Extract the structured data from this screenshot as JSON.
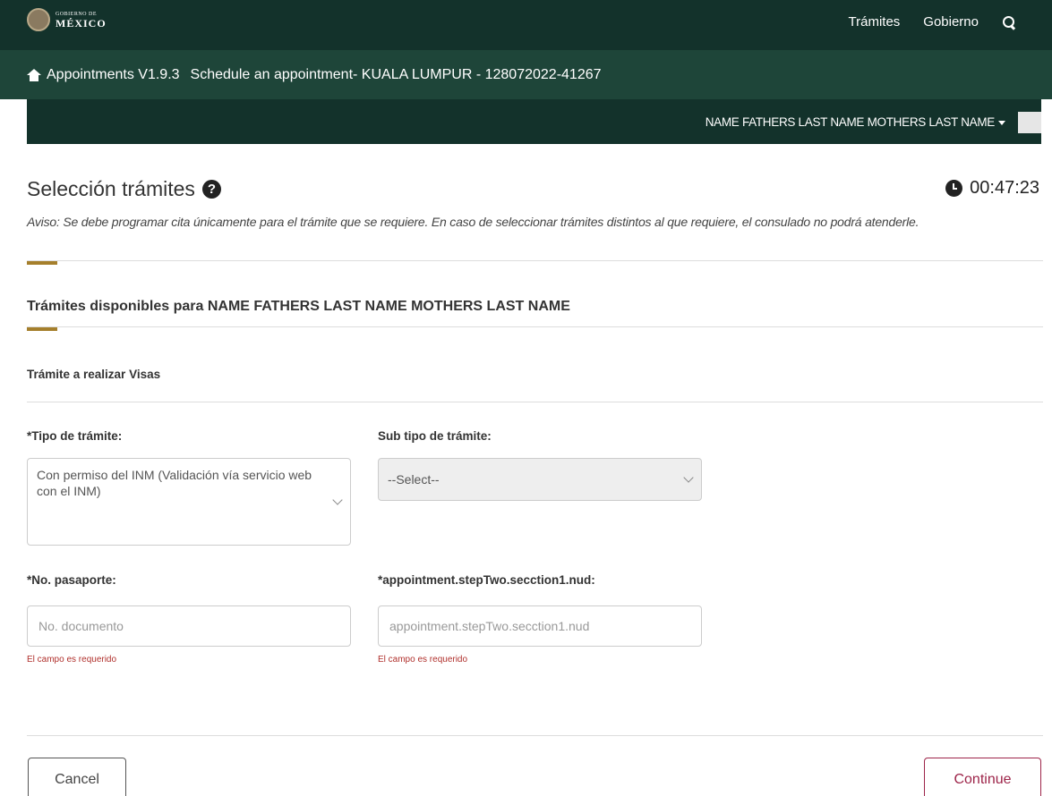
{
  "gov_header": {
    "logo_small": "GOBIERNO DE",
    "logo_big": "MÉXICO",
    "nav": [
      "Trámites",
      "Gobierno"
    ],
    "search_icon": "search-icon"
  },
  "breadcrumb": {
    "home_icon": "home-icon",
    "app": "Appointments V1.9.3",
    "page": "Schedule an appointment- KUALA LUMPUR - 128072022-41267"
  },
  "user_menu": {
    "name": "NAME FATHERS LAST NAME MOTHERS LAST NAME"
  },
  "heading": {
    "title": "Selección trámites",
    "help_icon": "question-circle-icon",
    "timer": "00:47:23",
    "timer_icon": "clock-icon"
  },
  "notice": "Aviso: Se debe programar cita únicamente para el trámite que se requiere. En caso de seleccionar trámites distintos al que requiere, el consulado no podrá atenderle.",
  "section": {
    "title": "Trámites disponibles para NAME FATHERS LAST NAME MOTHERS LAST NAME",
    "subtitle": "Trámite a realizar Visas"
  },
  "form": {
    "tipo": {
      "label": "*Tipo de trámite:",
      "value": "Con permiso del INM (Validación vía servicio web con el INM)"
    },
    "subtipo": {
      "label": "Sub tipo de trámite:",
      "value": "--Select--"
    },
    "pasaporte": {
      "label": "*No. pasaporte:",
      "placeholder": "No. documento",
      "error": "El campo es requerido"
    },
    "nud": {
      "label": "*appointment.stepTwo.secction1.nud:",
      "placeholder": "appointment.stepTwo.secction1.nud",
      "error": "El campo es requerido"
    }
  },
  "actions": {
    "cancel": "Cancel",
    "continue": "Continue"
  },
  "colors": {
    "header_dark": "#13322b",
    "header_mid": "#1e4539",
    "gold_accent": "#a57f2c",
    "continue_accent": "#9d2449",
    "error": "#b0302c"
  }
}
